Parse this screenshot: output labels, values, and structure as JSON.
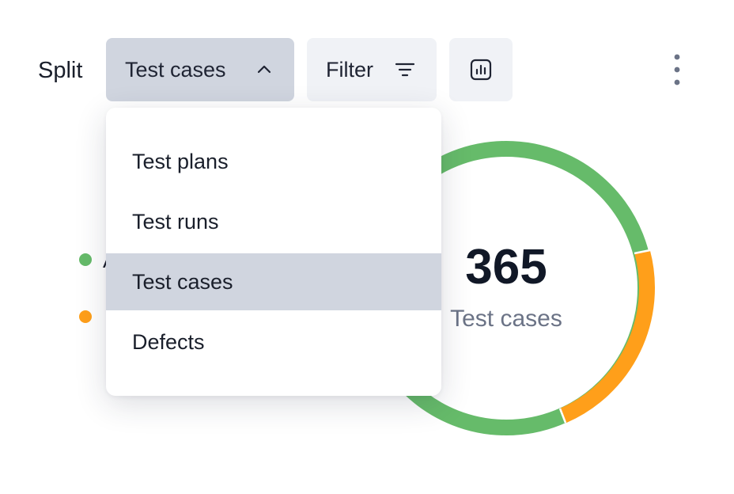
{
  "toolbar": {
    "split_label": "Split",
    "split_value": "Test cases",
    "filter_label": "Filter"
  },
  "icons": {
    "split_toggle": "chevron-up-icon",
    "filter": "filter-lines-icon",
    "chart": "bar-chart-icon",
    "more": "more-vertical-icon"
  },
  "dropdown": {
    "options": [
      "Test plans",
      "Test runs",
      "Test cases",
      "Defects"
    ],
    "selected": "Test cases"
  },
  "chart_data": {
    "type": "pie",
    "total": "365",
    "total_label": "Test cases",
    "series_colors": [
      "#66bb6a",
      "#ff9f1a"
    ]
  },
  "legend": {
    "items": [
      {
        "label": "A",
        "color": "#66bb6a"
      },
      {
        "label": "",
        "color": "#ff9f1a"
      }
    ]
  }
}
